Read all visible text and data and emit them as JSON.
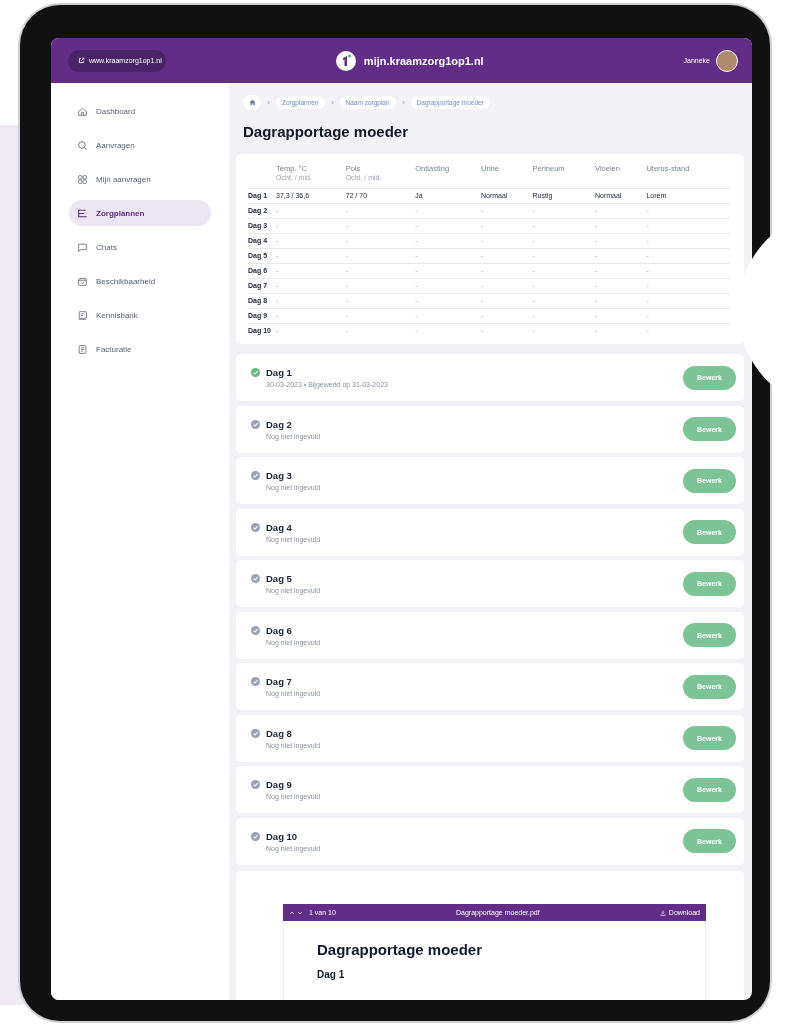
{
  "header": {
    "website_link": "www.kraamzorg1op1.nl",
    "site_title": "mijn.kraamzorg1op1.nl",
    "user_name": "Janneke"
  },
  "sidebar": {
    "items": [
      {
        "label": "Dashboard",
        "selected": false
      },
      {
        "label": "Aanvragen",
        "selected": false
      },
      {
        "label": "Mijn aanvragen",
        "selected": false
      },
      {
        "label": "Zorgplannen",
        "selected": true
      },
      {
        "label": "Chats",
        "selected": false
      },
      {
        "label": "Beschikbaarheid",
        "selected": false
      },
      {
        "label": "Kennisbank",
        "selected": false
      },
      {
        "label": "Facturatie",
        "selected": false
      }
    ]
  },
  "breadcrumb": [
    "Zorgplannen",
    "Naam zorgplan",
    "Dagrapportage moeder"
  ],
  "page_title": "Dagrapportage moeder",
  "table": {
    "columns": [
      {
        "label": "Temp. °C",
        "sublabel": "Ocht. / mid."
      },
      {
        "label": "Pols",
        "sublabel": "Ocht. / mid."
      },
      {
        "label": "Ontlasting"
      },
      {
        "label": "Urine"
      },
      {
        "label": "Perineum"
      },
      {
        "label": "Vloeien"
      },
      {
        "label": "Uterus-stand"
      }
    ],
    "rows": [
      {
        "label": "Dag 1",
        "cells": [
          "37,3 / 36,6",
          "72 / 70",
          "Ja",
          "Normaal",
          "Rustig",
          "Normaal",
          "Lorem"
        ]
      },
      {
        "label": "Dag 2",
        "cells": [
          "-",
          "-",
          "-",
          "-",
          "-",
          "-",
          "-"
        ]
      },
      {
        "label": "Dag 3",
        "cells": [
          "-",
          "-",
          "-",
          "-",
          "-",
          "-",
          "-"
        ]
      },
      {
        "label": "Dag 4",
        "cells": [
          "-",
          "-",
          "-",
          "-",
          "-",
          "-",
          "-"
        ]
      },
      {
        "label": "Dag 5",
        "cells": [
          "-",
          "-",
          "-",
          "-",
          "-",
          "-",
          "-"
        ]
      },
      {
        "label": "Dag 6",
        "cells": [
          "-",
          "-",
          "-",
          "-",
          "-",
          "-",
          "-"
        ]
      },
      {
        "label": "Dag 7",
        "cells": [
          "-",
          "-",
          "-",
          "-",
          "-",
          "-",
          "-"
        ]
      },
      {
        "label": "Dag 8",
        "cells": [
          "-",
          "-",
          "-",
          "-",
          "-",
          "-",
          "-"
        ]
      },
      {
        "label": "Dag 9",
        "cells": [
          "-",
          "-",
          "-",
          "-",
          "-",
          "-",
          "-"
        ]
      },
      {
        "label": "Dag 10",
        "cells": [
          "-",
          "-",
          "-",
          "-",
          "-",
          "-",
          "-"
        ]
      }
    ]
  },
  "days": [
    {
      "title": "Dag 1",
      "subtitle": "30-03-2023 • Bijgewerkt op 31-03-2023",
      "completed": true,
      "button": "Bewerk"
    },
    {
      "title": "Dag 2",
      "subtitle": "Nog niet ingevuld",
      "completed": false,
      "button": "Bewerk"
    },
    {
      "title": "Dag 3",
      "subtitle": "Nog niet ingevuld",
      "completed": false,
      "button": "Bewerk"
    },
    {
      "title": "Dag 4",
      "subtitle": "Nog niet ingevuld",
      "completed": false,
      "button": "Bewerk"
    },
    {
      "title": "Dag 5",
      "subtitle": "Nog niet ingevuld",
      "completed": false,
      "button": "Bewerk"
    },
    {
      "title": "Dag 6",
      "subtitle": "Nog niet ingevuld",
      "completed": false,
      "button": "Bewerk"
    },
    {
      "title": "Dag 7",
      "subtitle": "Nog niet ingevuld",
      "completed": false,
      "button": "Bewerk"
    },
    {
      "title": "Dag 8",
      "subtitle": "Nog niet ingevuld",
      "completed": false,
      "button": "Bewerk"
    },
    {
      "title": "Dag 9",
      "subtitle": "Nog niet ingevuld",
      "completed": false,
      "button": "Bewerk"
    },
    {
      "title": "Dag 10",
      "subtitle": "Nog niet ingevuld",
      "completed": false,
      "button": "Bewerk"
    }
  ],
  "pdf_viewer": {
    "page_indicator": "1 van 10",
    "filename": "Dagrapportage moeder.pdf",
    "download": "Download",
    "document_title": "Dagrapportage moeder",
    "section_title": "Dag 1"
  }
}
